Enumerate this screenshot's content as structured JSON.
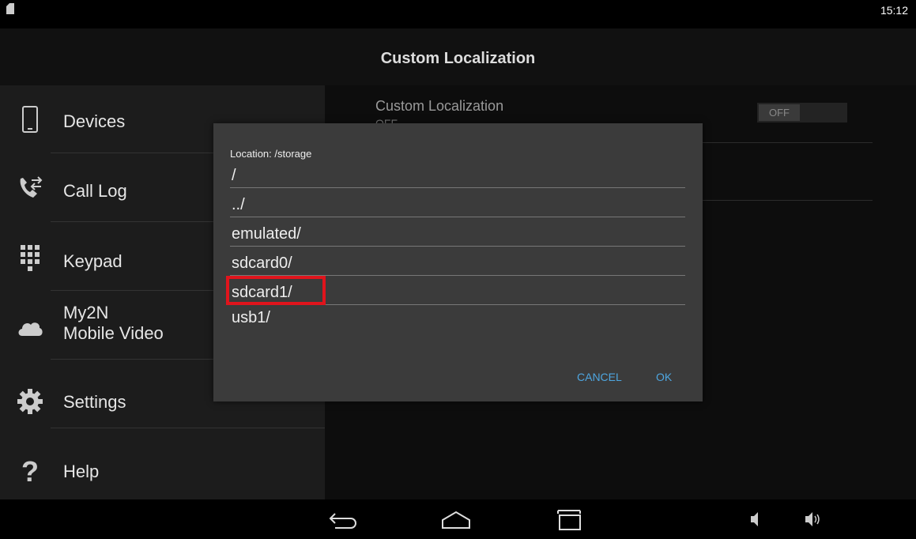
{
  "status_bar": {
    "time": "15:12",
    "sd_icon": "sdcard-icon"
  },
  "title": "Custom Localization",
  "sidebar": {
    "items": [
      {
        "label": "Devices",
        "icon": "phone-icon"
      },
      {
        "label": "Call Log",
        "icon": "call-log-icon"
      },
      {
        "label": "Keypad",
        "icon": "keypad-icon"
      },
      {
        "label_line1": "My2N",
        "label_line2": "Mobile Video",
        "icon": "cloud-icon"
      },
      {
        "label": "Settings",
        "icon": "gear-icon"
      },
      {
        "label": "Help",
        "icon": "question-icon"
      }
    ]
  },
  "setting": {
    "title": "Custom Localization",
    "subtitle": "OFF",
    "toggle": "OFF"
  },
  "dialog": {
    "location": "Location: /storage",
    "entries": [
      "/",
      "../",
      "emulated/",
      "sdcard0/",
      "sdcard1/",
      "usb1/"
    ],
    "cancel": "CANCEL",
    "ok": "OK",
    "highlight_color": "#e0141c",
    "accent_color": "#4ea6e0"
  },
  "nav": {
    "back": "back-icon",
    "home": "home-icon",
    "recents": "recents-icon",
    "vol_down": "volume-down-icon",
    "vol_up": "volume-up-icon"
  }
}
